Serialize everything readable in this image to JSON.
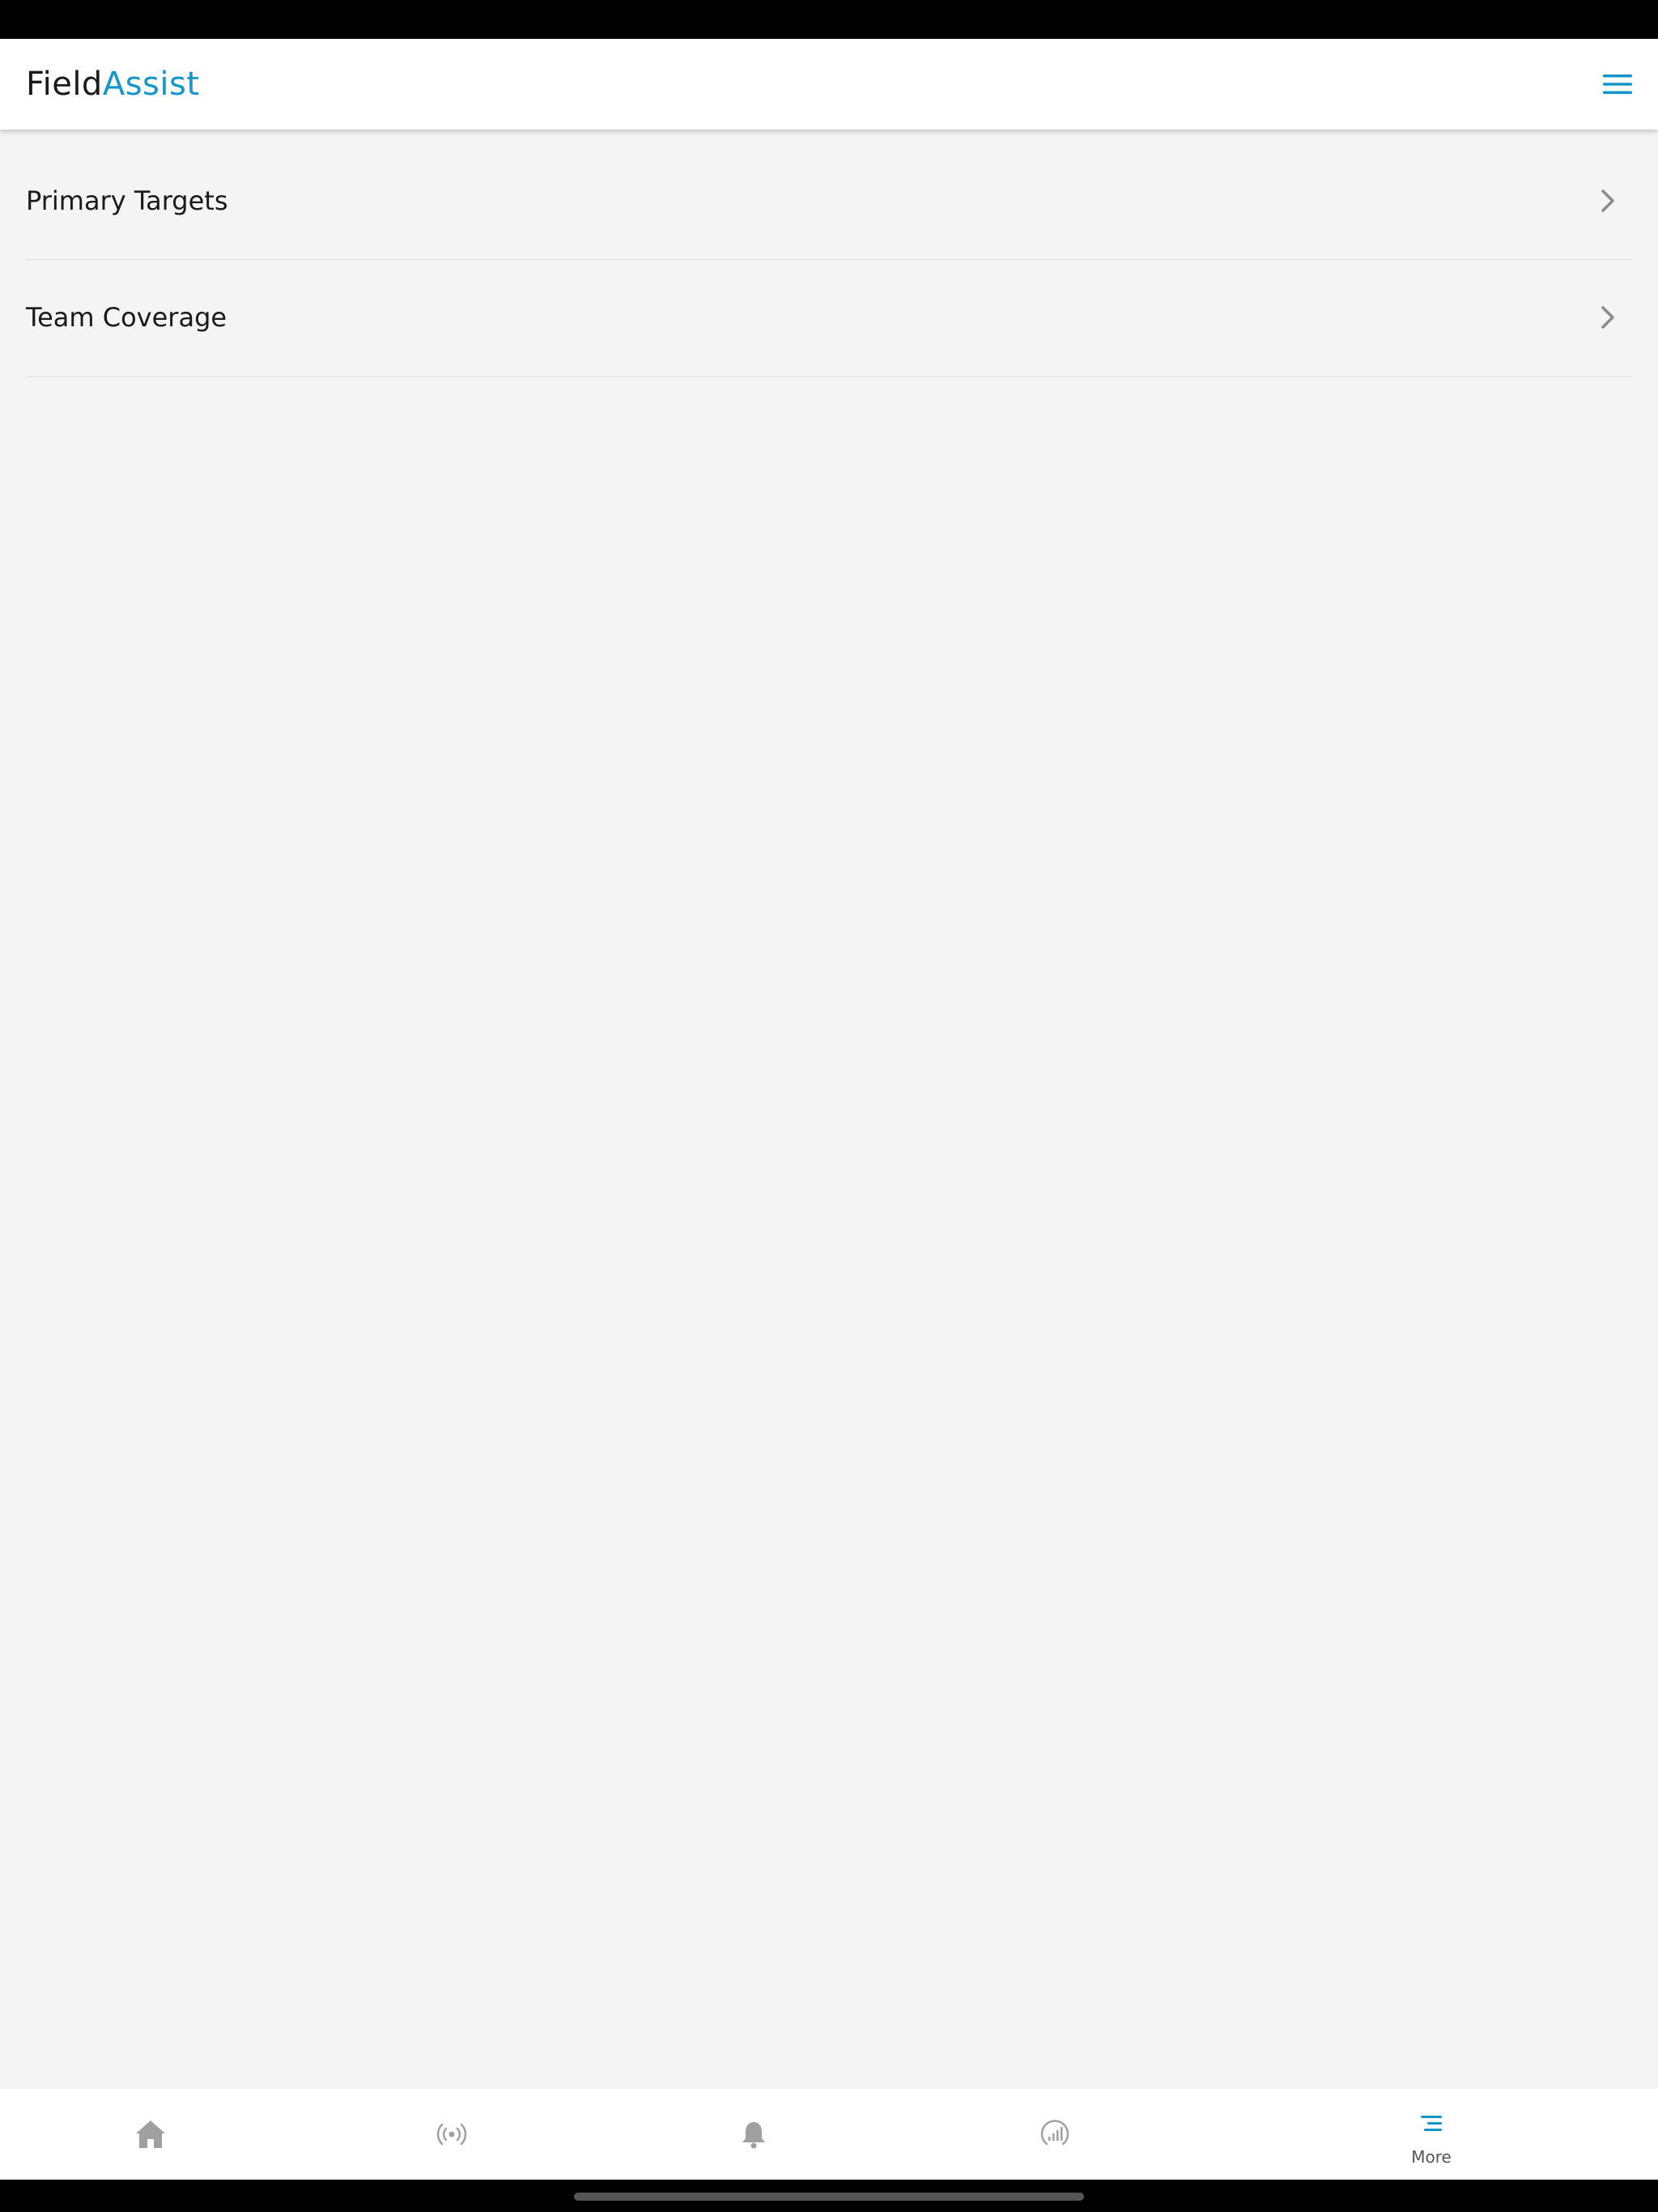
{
  "header": {
    "logo_part1": "Field",
    "logo_part2": "Assist",
    "menu_icon": "hamburger-menu-icon"
  },
  "list": {
    "items": [
      {
        "label": "Primary Targets",
        "icon": "chevron-right-icon"
      },
      {
        "label": "Team Coverage",
        "icon": "chevron-right-icon"
      }
    ]
  },
  "bottom_nav": {
    "items": [
      {
        "icon": "home-icon",
        "label": ""
      },
      {
        "icon": "broadcast-icon",
        "label": ""
      },
      {
        "icon": "bell-icon",
        "label": ""
      },
      {
        "icon": "dashboard-gauge-icon",
        "label": ""
      },
      {
        "icon": "more-menu-icon",
        "label": "More",
        "active": true
      }
    ]
  },
  "colors": {
    "accent": "#1496c8",
    "background": "#f4f4f4",
    "text": "#1a1a1a",
    "icon_inactive": "#a0a0a0"
  }
}
